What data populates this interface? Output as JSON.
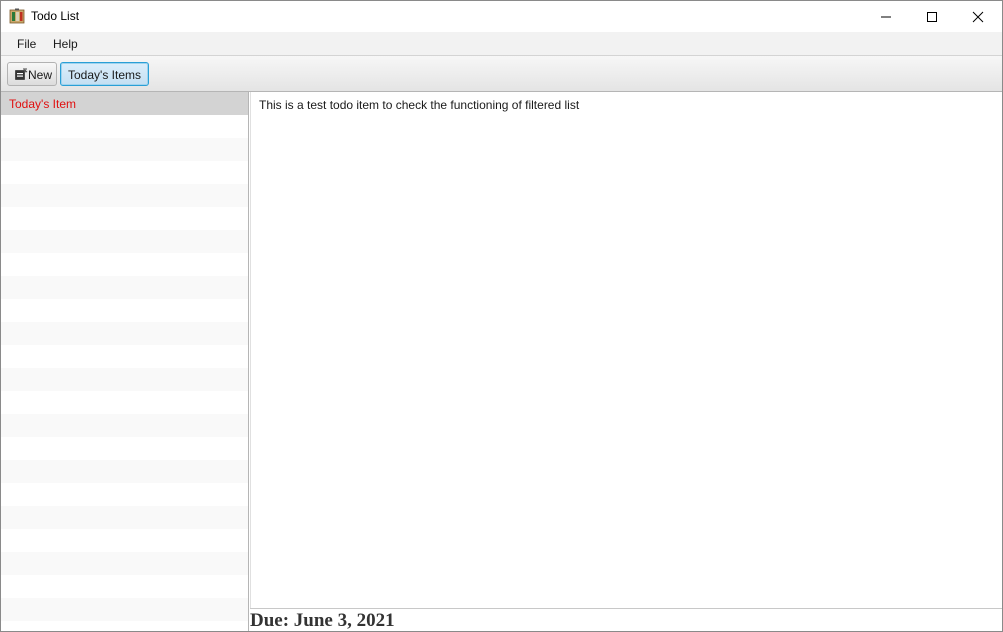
{
  "window": {
    "title": "Todo List",
    "icon": "notebook-icon"
  },
  "menu": {
    "items": [
      {
        "label": "File"
      },
      {
        "label": "Help"
      }
    ]
  },
  "toolbar": {
    "new_label": "New",
    "new_icon": "new-item-icon",
    "today_label": "Today's Items"
  },
  "todo_list": {
    "items": [
      {
        "label": "Today's Item",
        "selected": true,
        "color": "#e01010"
      }
    ]
  },
  "detail": {
    "description": "This is a test todo item to check the functioning of filtered list",
    "due": "Due: June 3, 2021"
  },
  "colors": {
    "selected_row": "#d3d3d3",
    "focused_button_border": "#2a9fd6",
    "item_text": "#e01010"
  }
}
